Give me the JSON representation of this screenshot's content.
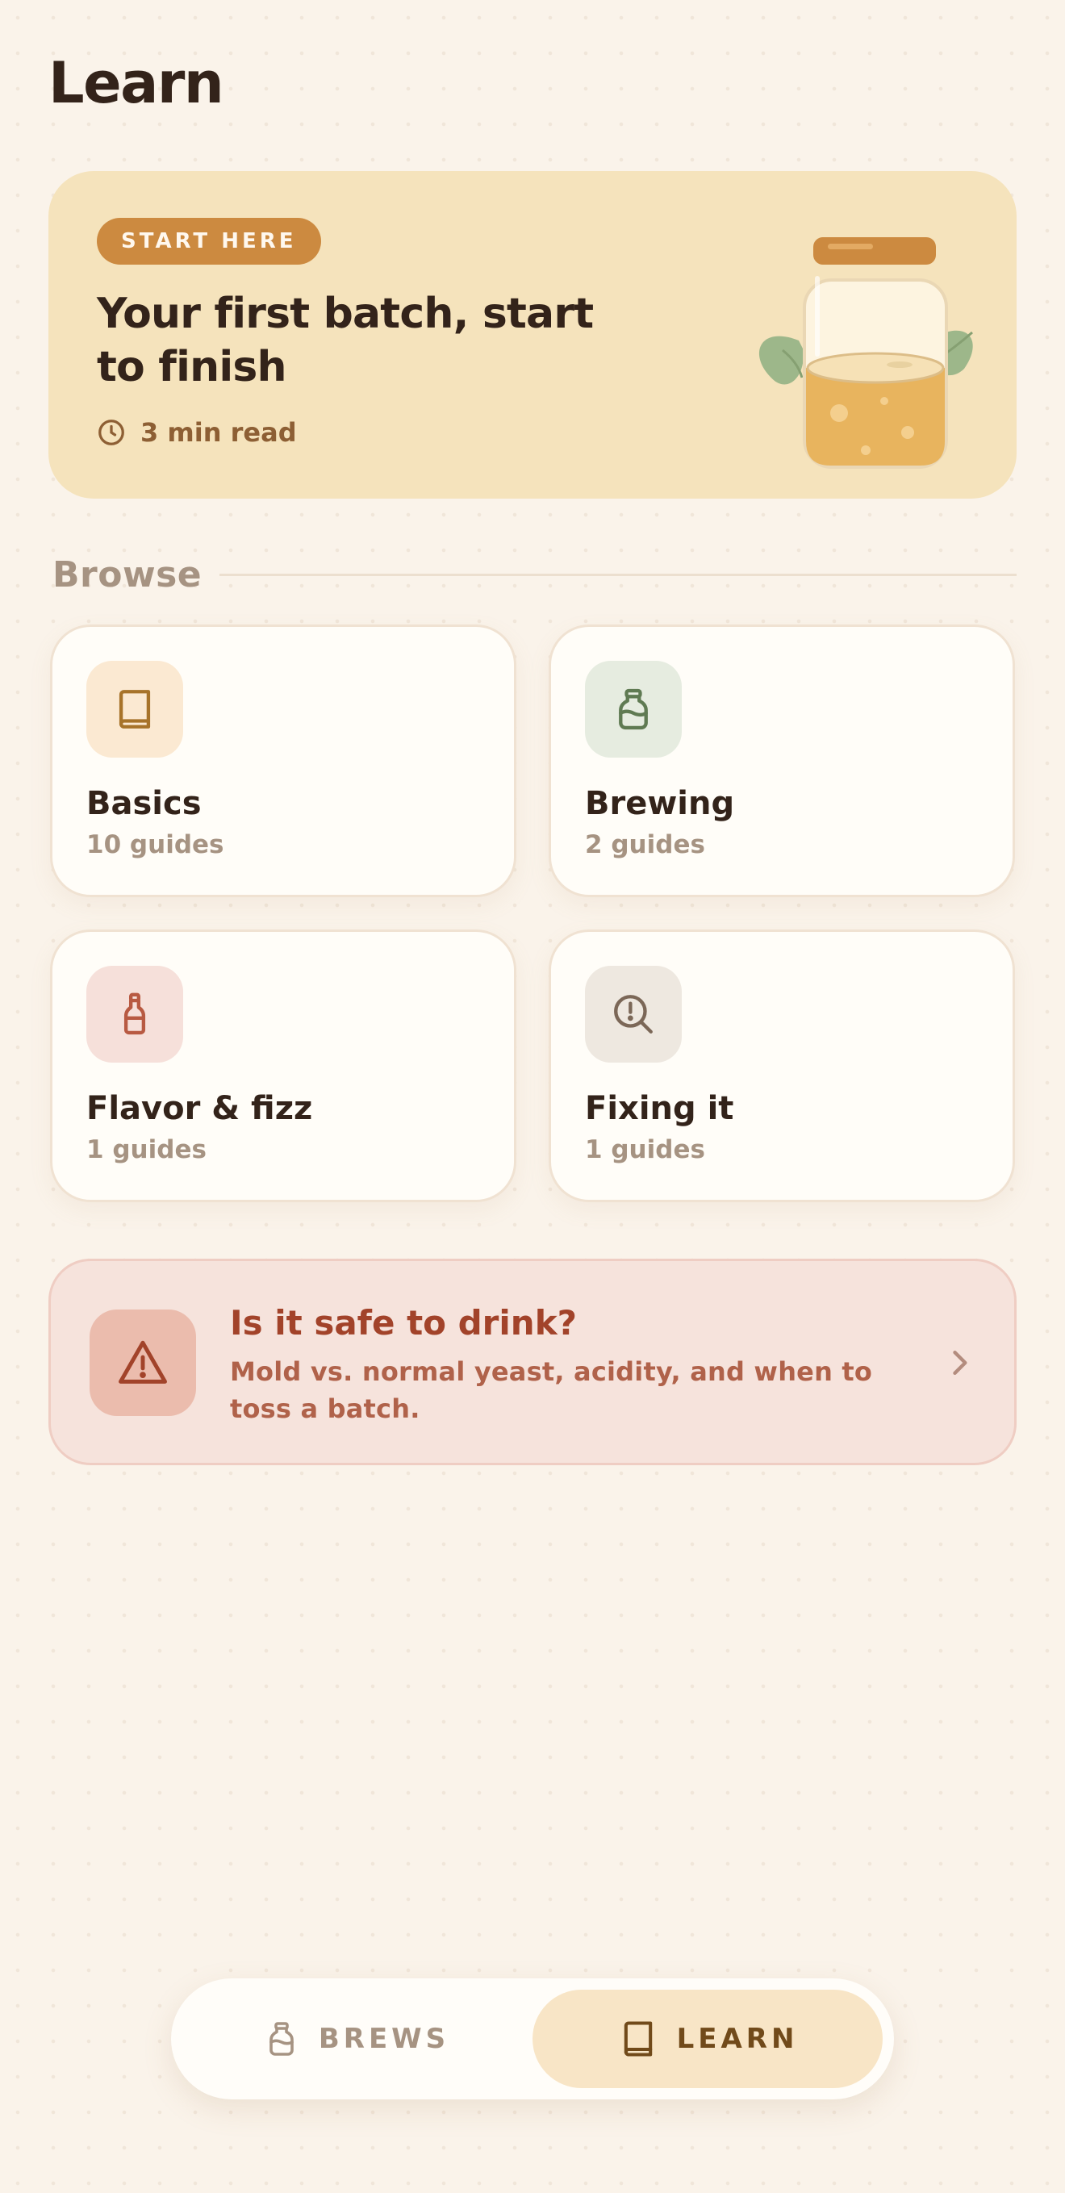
{
  "page": {
    "title": "Learn"
  },
  "hero": {
    "badge": "START HERE",
    "title": "Your first batch, start to finish",
    "meta_icon": "clock-icon",
    "read_time": "3 min read",
    "illustration": "kombucha-jar-illustration"
  },
  "browse": {
    "title": "Browse",
    "categories": [
      {
        "title": "Basics",
        "count": "10 guides",
        "icon": "book-icon",
        "icon_bg": "#fbe9d2",
        "icon_color": "#a7732a"
      },
      {
        "title": "Brewing",
        "count": "2 guides",
        "icon": "jar-icon",
        "icon_bg": "#e6ece0",
        "icon_color": "#5f7a52"
      },
      {
        "title": "Flavor & fizz",
        "count": "1 guides",
        "icon": "bottle-icon",
        "icon_bg": "#f6e0da",
        "icon_color": "#b85a42"
      },
      {
        "title": "Fixing it",
        "count": "1 guides",
        "icon": "search-alert-icon",
        "icon_bg": "#eee8e0",
        "icon_color": "#7b6757"
      }
    ]
  },
  "safety": {
    "title": "Is it safe to drink?",
    "description": "Mold vs. normal yeast, acidity, and when to toss a batch.",
    "icon": "warning-icon",
    "chevron": "chevron-right-icon"
  },
  "nav": {
    "items": [
      {
        "label": "BREWS",
        "icon": "jar-icon",
        "active": false
      },
      {
        "label": "LEARN",
        "icon": "book-icon",
        "active": true
      }
    ]
  },
  "colors": {
    "background": "#faf3ea",
    "accent": "#cc8a40",
    "hero_bg": "#f5e3bc",
    "danger": "#a2432a"
  }
}
